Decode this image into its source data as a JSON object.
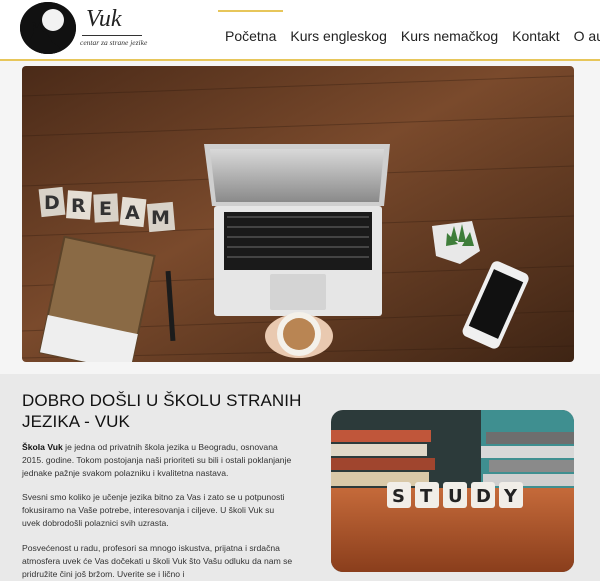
{
  "brand": {
    "name": "Vuk",
    "tagline": "centar za strane jezike"
  },
  "nav": {
    "items": [
      "Početna",
      "Kurs engleskog",
      "Kurs nemačkog",
      "Kontakt",
      "O autoru"
    ],
    "active": "Početna"
  },
  "hero": {
    "word_tiles": [
      "D",
      "R",
      "E",
      "A",
      "M"
    ]
  },
  "intro": {
    "title": "DOBRO DOŠLI U ŠKOLU STRANIH JEZIKA - VUK",
    "p1_strong": "Škola Vuk",
    "p1_rest": " je jedna od privatnih škola jezika u Beogradu, osnovana 2015. godine. Tokom postojanja naši prioriteti su bili i ostali poklanjanje jednake pažnje svakom polazniku i kvalitetna nastava.",
    "p2": "Svesni smo koliko je učenje jezika bitno za Vas i zato se u potpunosti fokusiramo na Vaše potrebe, interesovanja i ciljeve. U školi Vuk su uvek dobrodošli polaznici svih uzrasta.",
    "p3": "Posvećenost u radu, profesori sa mnogo iskustva, prijatna i srdačna atmosfera uvek će Vas dočekati u školi Vuk što Vašu odluku da nam se pridružite čini još bržom. Uverite se i lično i"
  },
  "study_image": {
    "tiles": [
      "S",
      "T",
      "U",
      "D",
      "Y"
    ]
  },
  "colors": {
    "accent": "#e7c65a",
    "section_bg": "#e9e9e9",
    "wood": "#6b4026"
  }
}
